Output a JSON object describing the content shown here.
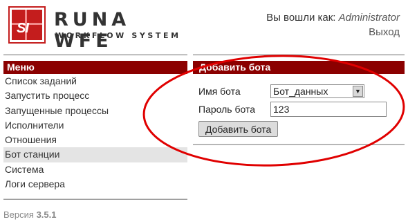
{
  "header": {
    "logo_monogram": "SI",
    "logo_title": "RUNA WFE",
    "logo_subtitle": "WORKFLOW SYSTEM",
    "login_prefix": "Вы вошли как:",
    "login_user": "Administrator",
    "logout_label": "Выход"
  },
  "sidebar": {
    "title": "Меню",
    "items": [
      {
        "label": "Список заданий"
      },
      {
        "label": "Запустить процесс"
      },
      {
        "label": "Запущенные процессы"
      },
      {
        "label": "Исполнители"
      },
      {
        "label": "Отношения"
      },
      {
        "label": "Бот станции"
      },
      {
        "label": "Система"
      },
      {
        "label": "Логи сервера"
      }
    ],
    "active_index": 5,
    "version_prefix": "Версия",
    "version_number": "3.5.1"
  },
  "main": {
    "title": "Добавить бота",
    "bot_name_label": "Имя бота",
    "bot_name_value": "Бот_данных",
    "bot_password_label": "Пароль бота",
    "bot_password_value": "123",
    "submit_label": "Добавить бота"
  },
  "colors": {
    "panel_header": "#8b0000",
    "annotation": "#e00000",
    "logo": "#c41d1d"
  }
}
